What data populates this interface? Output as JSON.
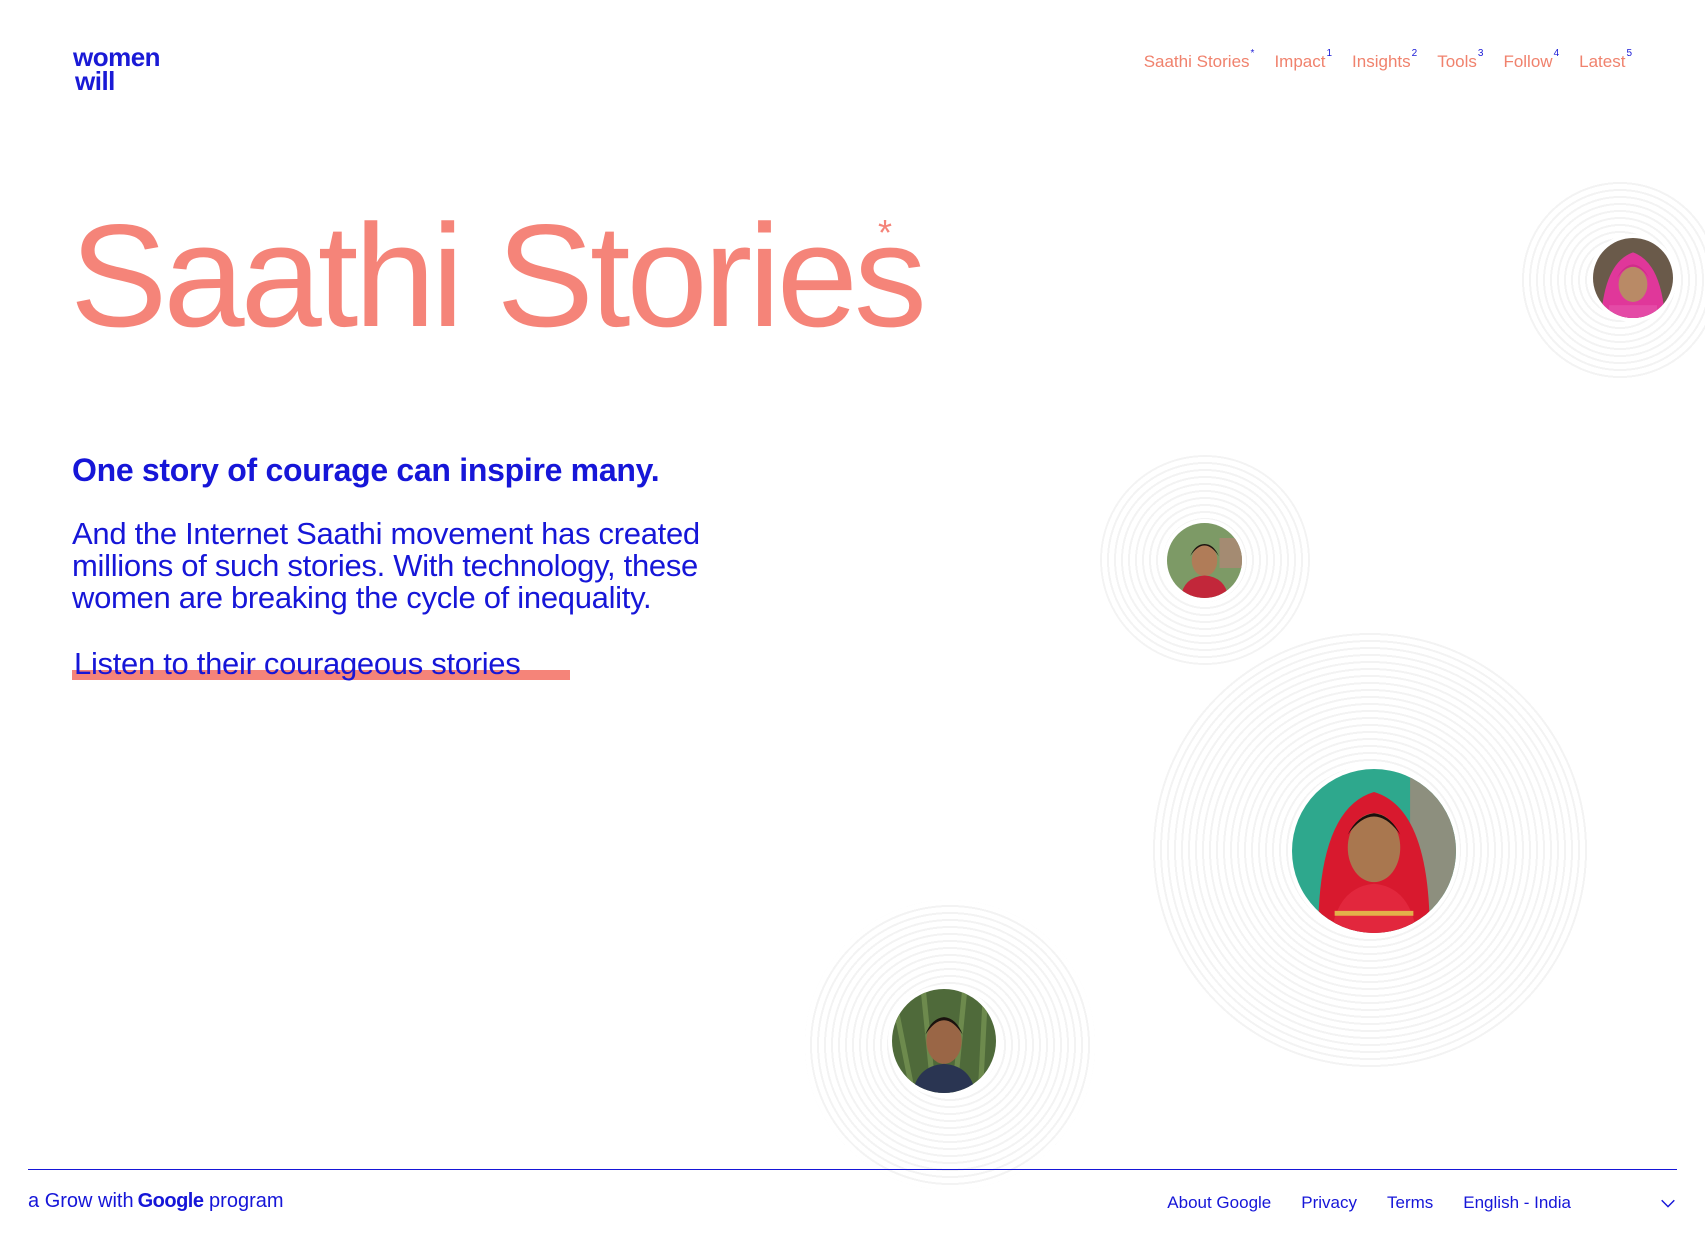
{
  "logo": {
    "line1": "women",
    "line2": "will"
  },
  "nav": {
    "items": [
      {
        "label": "Saathi Stories",
        "sup": "*"
      },
      {
        "label": "Impact",
        "sup": "1"
      },
      {
        "label": "Insights",
        "sup": "2"
      },
      {
        "label": "Tools",
        "sup": "3"
      },
      {
        "label": "Follow",
        "sup": "4"
      },
      {
        "label": "Latest",
        "sup": "5"
      }
    ]
  },
  "hero": {
    "title": "Saathi Stories",
    "title_mark": "*",
    "lead": "One story of courage can inspire many.",
    "body": "And the Internet Saathi movement has created millions of such stories. With technology, these women are breaking the cycle of inequality.",
    "cta": "Listen to their courageous stories"
  },
  "portraits": [
    {
      "name": "portrait-top-right",
      "icon": "woman-pink-headscarf"
    },
    {
      "name": "portrait-middle",
      "icon": "woman-outdoor"
    },
    {
      "name": "portrait-large",
      "icon": "woman-red-saree"
    },
    {
      "name": "portrait-bottom",
      "icon": "woman-field"
    }
  ],
  "footer": {
    "brand_prefix": "a",
    "brand_grow": "Grow with",
    "brand_google": "Google",
    "brand_suffix": "program",
    "links": [
      "About Google",
      "Privacy",
      "Terms"
    ],
    "language": "English - India"
  },
  "colors": {
    "coral": "#f58479",
    "blue": "#1616d8"
  }
}
